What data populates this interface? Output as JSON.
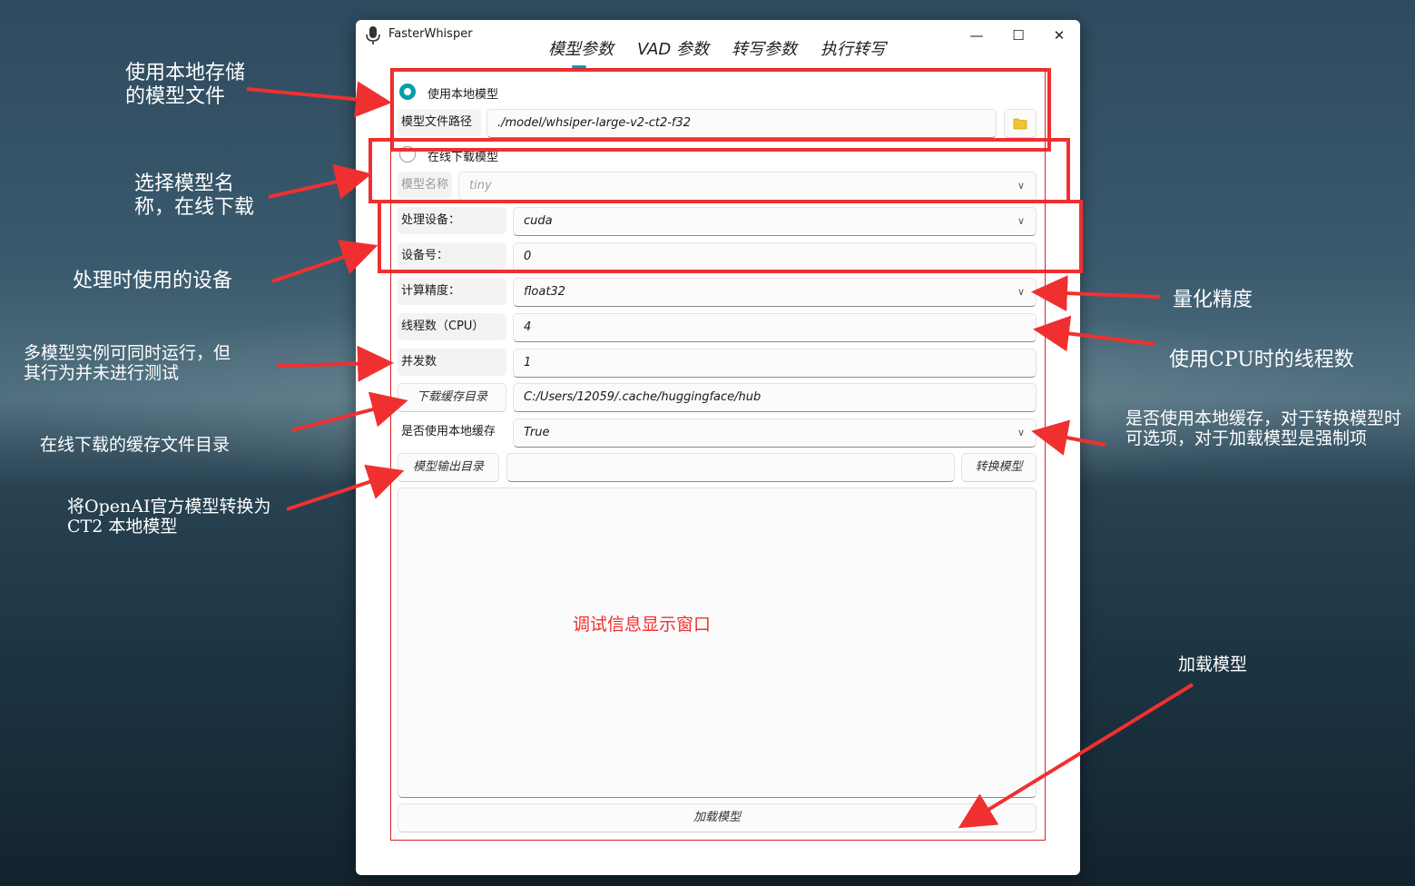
{
  "window": {
    "title": "FasterWhisper",
    "controls": {
      "minimize": "—",
      "maximize": "☐",
      "close": "✕"
    }
  },
  "tabs": [
    {
      "label": "模型参数",
      "active": true
    },
    {
      "label": "VAD 参数"
    },
    {
      "label": "转写参数"
    },
    {
      "label": "执行转写"
    }
  ],
  "model": {
    "local_radio_label": "使用本地模型",
    "local_path_label": "模型文件路径",
    "local_path_value": "./model/whsiper-large-v2-ct2-f32",
    "online_radio_label": "在线下载模型",
    "model_name_label": "模型名称",
    "model_name_value": "tiny"
  },
  "device": {
    "device_label": "处理设备：",
    "device_value": "cuda",
    "device_index_label": "设备号：",
    "device_index_value": "0"
  },
  "compute": {
    "precision_label": "计算精度：",
    "precision_value": "float32",
    "threads_label": "线程数（CPU）",
    "threads_value": "4",
    "workers_label": "并发数",
    "workers_value": "1",
    "cache_dir_button": "下载缓存目录",
    "cache_dir_value": "C:/Users/12059/.cache/huggingface/hub",
    "use_local_cache_label": "是否使用本地缓存",
    "use_local_cache_value": "True",
    "output_dir_button": "模型输出目录",
    "output_dir_value": "",
    "convert_button": "转换模型",
    "load_button": "加载模型"
  },
  "annotations": {
    "local_model": "使用本地存储的模型文件",
    "online_model": "选择模型名称，在线下载",
    "device": "处理时使用的设备",
    "precision": "量化精度",
    "threads": "使用CPU时的线程数",
    "workers": "多模型实例可同时运行，但其行为并未进行测试",
    "cache_dir": "在线下载的缓存文件目录",
    "local_cache": "是否使用本地缓存，对于转换模型时可选项，对于加载模型是强制项",
    "convert": "将OpenAI官方模型转换为CT2 本地模型",
    "debug_window": "调试信息显示窗口",
    "load": "加载模型"
  },
  "colors": {
    "accent": "#009faa",
    "annotation_red": "#f03030"
  }
}
